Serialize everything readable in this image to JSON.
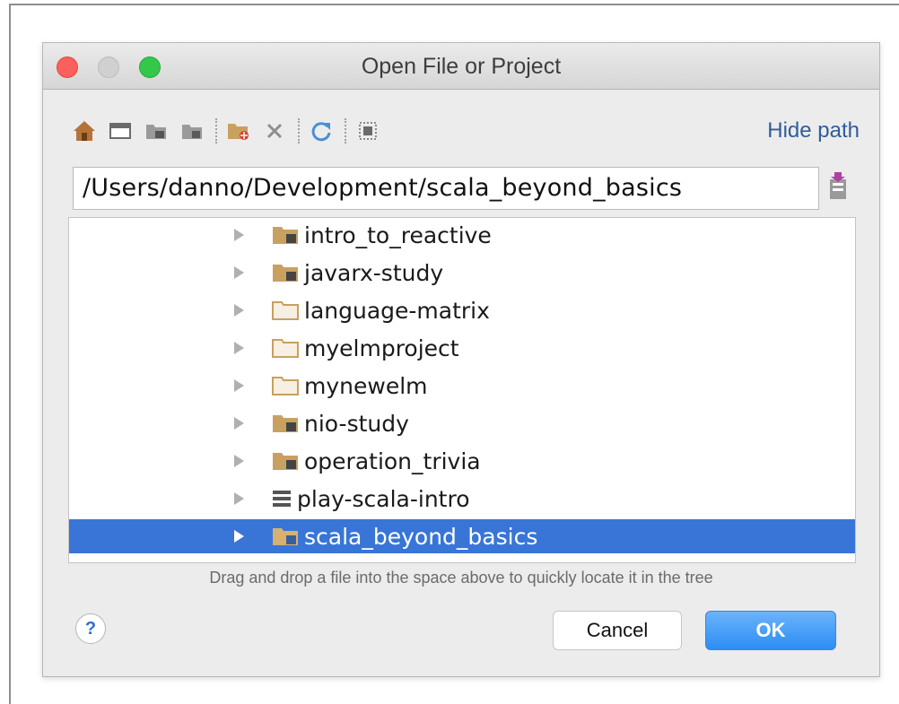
{
  "window": {
    "title": "Open File or Project"
  },
  "toolbar": {
    "buttons": [
      {
        "name": "home-icon"
      },
      {
        "name": "desktop-icon"
      },
      {
        "name": "project-folder-icon"
      },
      {
        "name": "module-folder-icon"
      },
      {
        "name": "new-folder-icon"
      },
      {
        "name": "delete-icon"
      },
      {
        "name": "refresh-icon"
      },
      {
        "name": "show-hidden-icon"
      }
    ],
    "hide_path_label": "Hide path"
  },
  "path": {
    "value": "/Users/danno/Development/scala_beyond_basics"
  },
  "tree": {
    "items": [
      {
        "label": "intro_to_reactive",
        "icon": "module-folder-icon",
        "selected": false
      },
      {
        "label": "javarx-study",
        "icon": "module-folder-icon",
        "selected": false
      },
      {
        "label": "language-matrix",
        "icon": "folder-icon",
        "selected": false
      },
      {
        "label": "myelmproject",
        "icon": "folder-icon",
        "selected": false
      },
      {
        "label": "mynewelm",
        "icon": "folder-icon",
        "selected": false
      },
      {
        "label": "nio-study",
        "icon": "module-folder-icon",
        "selected": false
      },
      {
        "label": "operation_trivia",
        "icon": "module-folder-icon",
        "selected": false
      },
      {
        "label": "play-scala-intro",
        "icon": "stack-icon",
        "selected": false
      },
      {
        "label": "scala_beyond_basics",
        "icon": "module-folder-icon",
        "selected": true
      }
    ]
  },
  "hint": "Drag and drop a file into the space above to quickly locate it in the tree",
  "buttons": {
    "help": "?",
    "cancel": "Cancel",
    "ok": "OK"
  },
  "colors": {
    "selection": "#3875d7",
    "ok_button": "#2c8df5",
    "link": "#2f5d9a",
    "folder": "#c8a060"
  }
}
